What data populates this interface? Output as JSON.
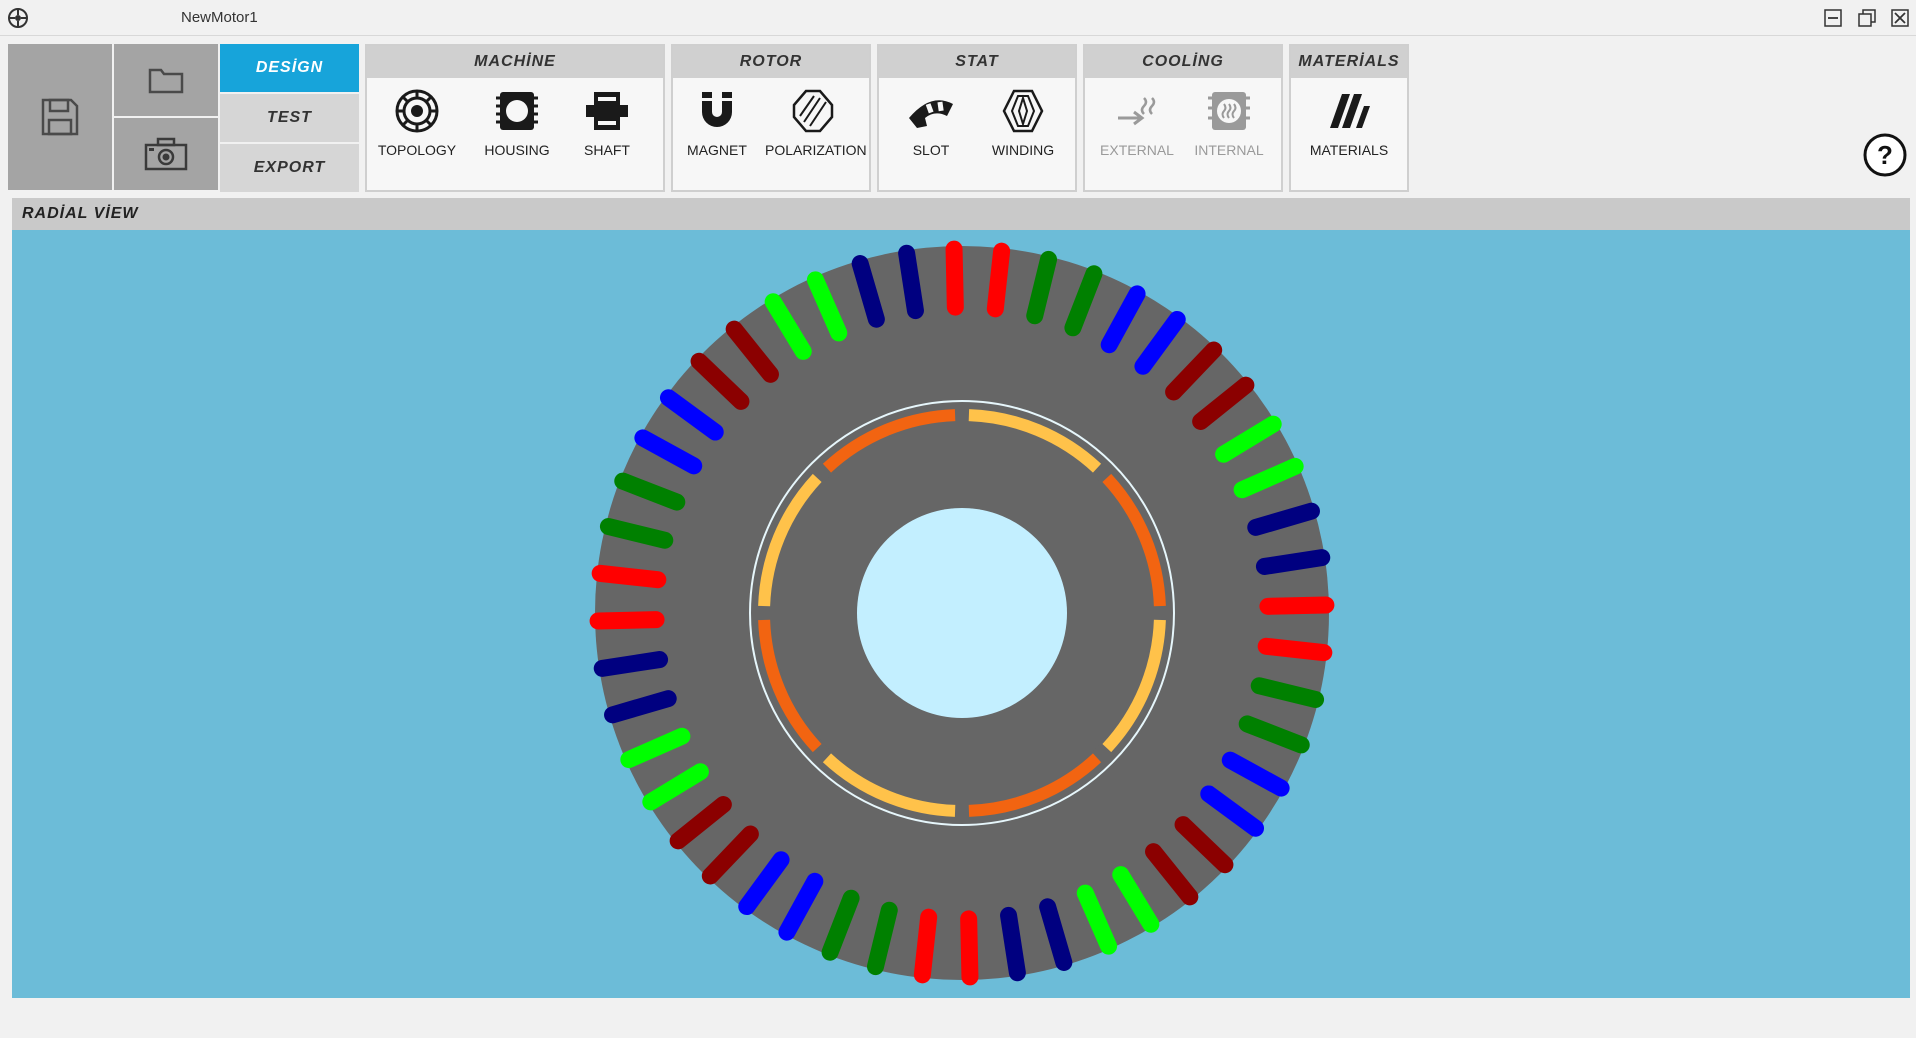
{
  "window": {
    "title": "NewMotor1"
  },
  "modes": [
    {
      "label": "DESİGN",
      "active": true
    },
    {
      "label": "TEST",
      "active": false
    },
    {
      "label": "EXPORT",
      "active": false
    }
  ],
  "groups": {
    "machine": {
      "title": "MACHİNE",
      "tools": [
        "TOPOLOGY",
        "HOUSING",
        "SHAFT"
      ]
    },
    "rotor": {
      "title": "ROTOR",
      "tools": [
        "MAGNET",
        "POLARIZATION"
      ]
    },
    "stator": {
      "title": "STAT",
      "tools": [
        "SLOT",
        "WINDING"
      ]
    },
    "cooling": {
      "title": "COOLİNG",
      "tools": [
        "EXTERNAL",
        "INTERNAL"
      ]
    },
    "materials": {
      "title": "MATERİALS",
      "tools": [
        "MATERIALS"
      ]
    }
  },
  "panel": {
    "title": "RADİAL VİEW"
  },
  "colors": {
    "accent": "#17a4da",
    "viewport_bg": "#6cbcd8",
    "stator": "#666666",
    "bore": "#c3efff",
    "magnet_a": "#ffc24a",
    "magnet_b": "#f26411"
  },
  "motor": {
    "slots": 48,
    "poles": 8,
    "phase_sequence": [
      "#ff0000",
      "#ff0000",
      "#008000",
      "#008000",
      "#0000ff",
      "#0000ff",
      "#8b0000",
      "#8b0000",
      "#00ff00",
      "#00ff00",
      "#000080",
      "#000080"
    ]
  }
}
